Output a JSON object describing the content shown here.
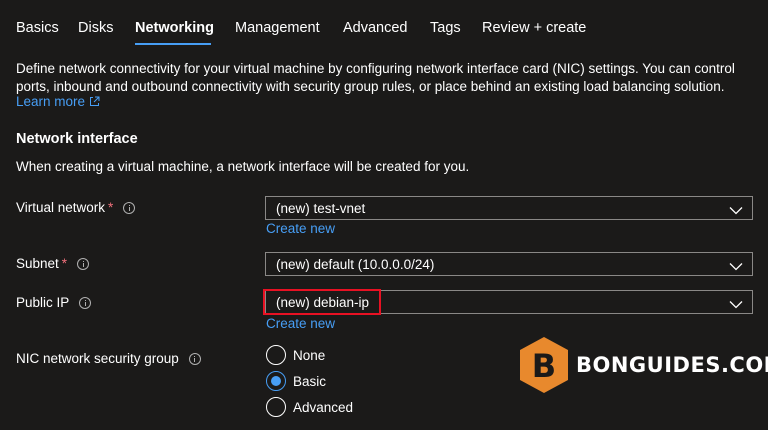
{
  "tabs": [
    {
      "label": "Basics"
    },
    {
      "label": "Disks"
    },
    {
      "label": "Networking"
    },
    {
      "label": "Management"
    },
    {
      "label": "Advanced"
    },
    {
      "label": "Tags"
    },
    {
      "label": "Review + create"
    }
  ],
  "active_tab": "Networking",
  "intro": {
    "text": "Define network connectivity for your virtual machine by configuring network interface card (NIC) settings. You can control ports, inbound and outbound connectivity with security group rules, or place behind an existing load balancing solution.",
    "learn_more": "Learn more"
  },
  "section": {
    "title": "Network interface",
    "description": "When creating a virtual machine, a network interface will be created for you."
  },
  "fields": {
    "virtual_network": {
      "label": "Virtual network",
      "required_mark": "*",
      "value": "(new) test-vnet",
      "create_new": "Create new"
    },
    "subnet": {
      "label": "Subnet",
      "required_mark": "*",
      "value": "(new) default (10.0.0.0/24)"
    },
    "public_ip": {
      "label": "Public IP",
      "value": "(new) debian-ip",
      "create_new": "Create new"
    },
    "nsg": {
      "label": "NIC network security group",
      "options": [
        {
          "label": "None",
          "selected": false
        },
        {
          "label": "Basic",
          "selected": true
        },
        {
          "label": "Advanced",
          "selected": false
        }
      ]
    }
  },
  "watermark": {
    "text": "BONGUIDES.COM",
    "badge_letter": "B",
    "badge_color": "#e8892d"
  },
  "colors": {
    "link": "#479ef5",
    "required": "#f1707b",
    "highlight": "#e81123",
    "background": "#1b1a19"
  }
}
